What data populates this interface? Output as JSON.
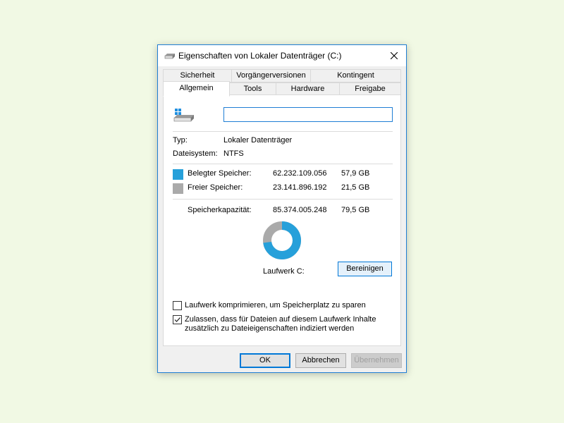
{
  "window": {
    "title": "Eigenschaften von Lokaler Datenträger (C:)",
    "accent_color": "#1f7ed4",
    "background_color": "#f1f9e4",
    "icons": {
      "title": "drive-icon",
      "close": "close-icon",
      "drive": "windows-drive-icon"
    }
  },
  "tabs": {
    "row1": [
      "Sicherheit",
      "Vorgängerversionen",
      "Kontingent"
    ],
    "row2": [
      "Allgemein",
      "Tools",
      "Hardware",
      "Freigabe"
    ],
    "active": "Allgemein"
  },
  "general": {
    "name_value": "",
    "type_label": "Typ:",
    "type_value": "Lokaler Datenträger",
    "fs_label": "Dateisystem:",
    "fs_value": "NTFS",
    "used": {
      "label": "Belegter Speicher:",
      "bytes": "62.232.109.056",
      "size": "57,9 GB",
      "color": "#26a0da"
    },
    "free": {
      "label": "Freier Speicher:",
      "bytes": "23.141.896.192",
      "size": "21,5 GB",
      "color": "#aaaaaa"
    },
    "capacity": {
      "label": "Speicherkapazität:",
      "bytes": "85.374.005.248",
      "size": "79,5 GB"
    },
    "used_fraction": 0.729,
    "drive_label": "Laufwerk C:",
    "cleanup_button": "Bereinigen",
    "compress_label": "Laufwerk komprimieren, um Speicherplatz zu sparen",
    "compress_checked": false,
    "index_label_line1": "Zulassen, dass für Dateien auf diesem Laufwerk Inhalte",
    "index_label_line2": "zusätzlich zu Dateieigenschaften indiziert werden",
    "index_checked": true
  },
  "buttons": {
    "ok": "OK",
    "cancel": "Abbrechen",
    "apply": "Übernehmen"
  }
}
